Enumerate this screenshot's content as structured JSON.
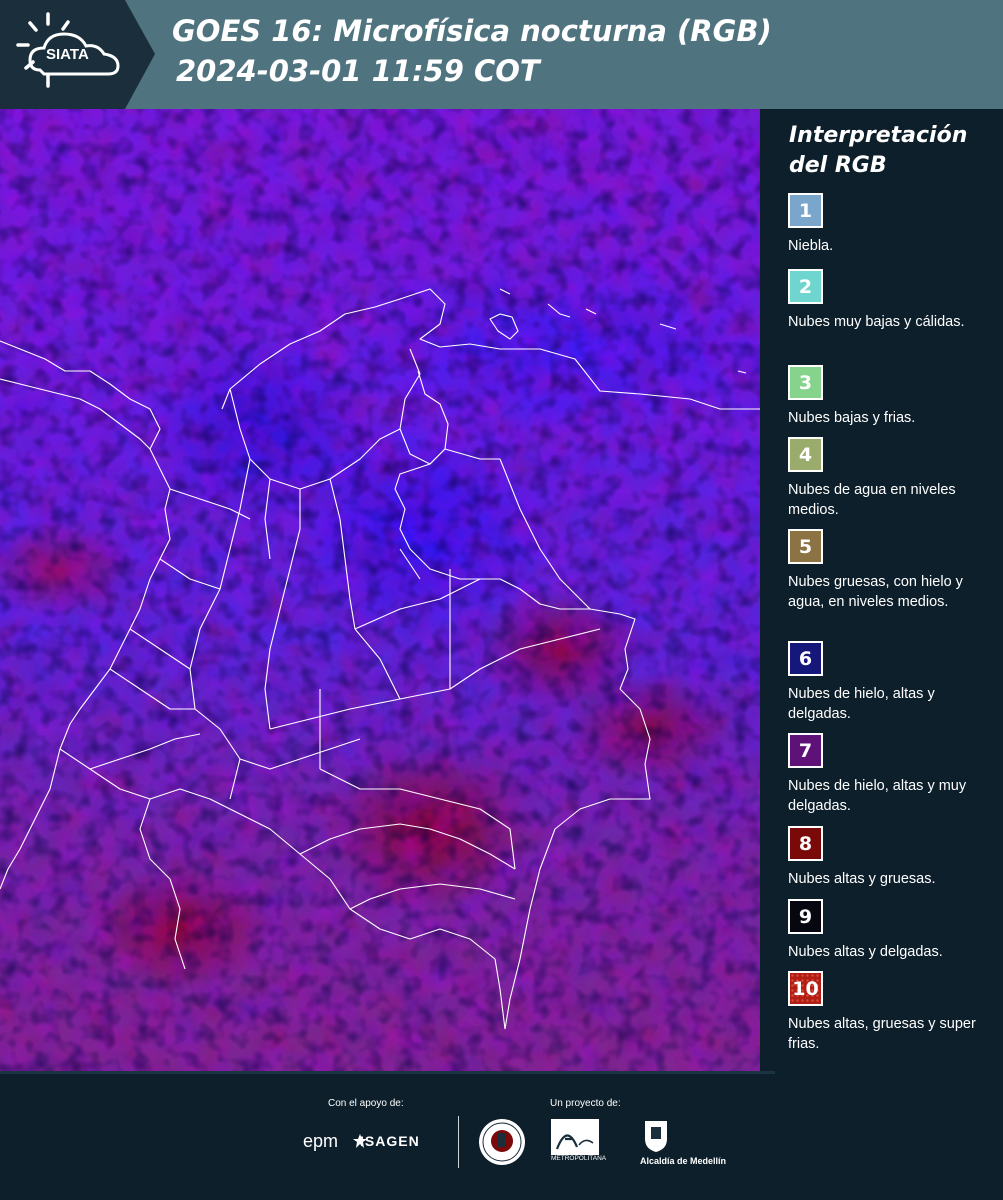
{
  "header": {
    "logo_text": "SIATA",
    "title_line1": "GOES 16: Microfísica nocturna (RGB)",
    "title_line2": "2024-03-01 11:59 COT",
    "colors": {
      "bar": "#4f7480",
      "logo_bg": "#1a2e3b"
    }
  },
  "legend": {
    "title": "Interpretación del RGB",
    "items": [
      {
        "number": "1",
        "label": "Niebla.",
        "color": "#7aa6cc"
      },
      {
        "number": "2",
        "label": "Nubes muy bajas y cálidas.",
        "color": "#6fd6cf"
      },
      {
        "number": "3",
        "label": "Nubes bajas y frias.",
        "color": "#86d48c"
      },
      {
        "number": "4",
        "label": "Nubes de agua en niveles medios.",
        "color": "#9aac6c"
      },
      {
        "number": "5",
        "label": "Nubes gruesas, con hielo y agua, en niveles medios.",
        "color": "#8c7344"
      },
      {
        "number": "6",
        "label": "Nubes de hielo, altas y delgadas.",
        "color": "#15177a"
      },
      {
        "number": "7",
        "label": "Nubes de hielo, altas y muy delgadas.",
        "color": "#5e1278"
      },
      {
        "number": "8",
        "label": "Nubes altas y gruesas.",
        "color": "#7a0a0a"
      },
      {
        "number": "9",
        "label": "Nubes altas y delgadas.",
        "color": "#070712"
      },
      {
        "number": "10",
        "label": "Nubes altas, gruesas y super frias.",
        "color": "#b21d14"
      }
    ]
  },
  "footer": {
    "support_label": "Con el apoyo de:",
    "project_label": "Un proyecto de:",
    "epm": "epm",
    "isagen": "ISAGEN",
    "metro_label": "METROPOLITANA",
    "alcaldia": "Alcaldía de Medellín"
  }
}
